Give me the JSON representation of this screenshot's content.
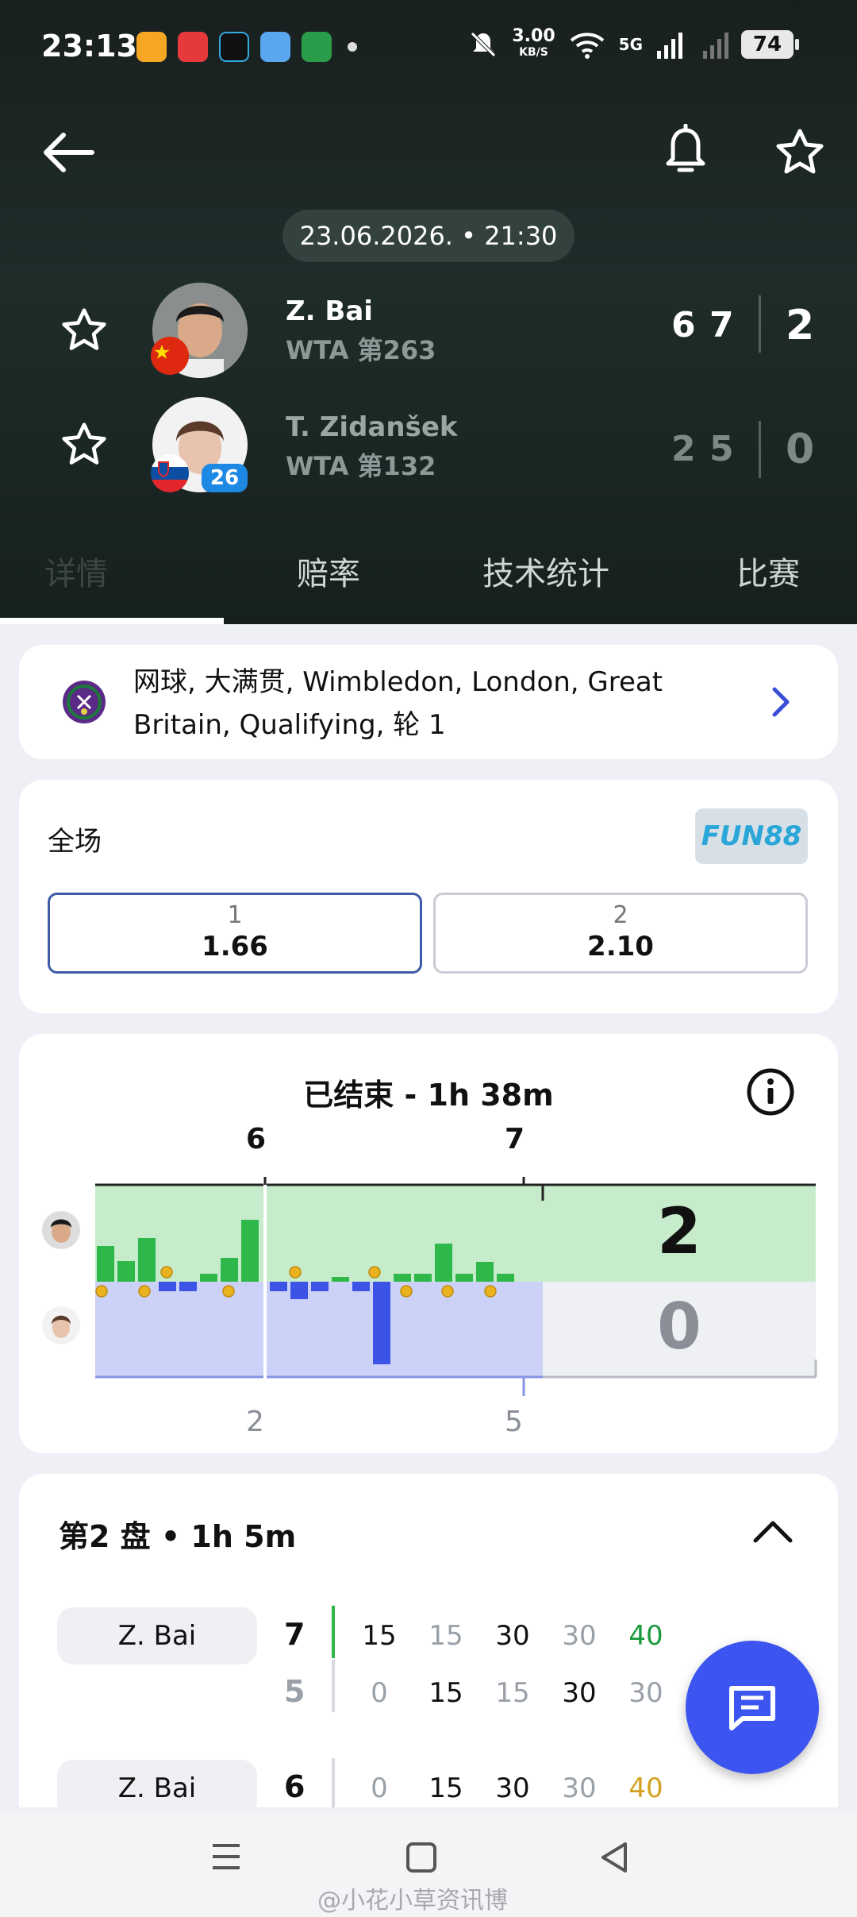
{
  "status_bar": {
    "time": "23:13",
    "speed": "3.00",
    "speed_unit": "KB/S",
    "network": "5G",
    "battery": "74",
    "icons": [
      "weibo-icon",
      "video-icon",
      "tiktok-icon",
      "weather-icon",
      "oppo-icon",
      "mute-icon",
      "wifi-icon",
      "signal-icon"
    ]
  },
  "header": {
    "date_time": "23.06.2026. • 21:30",
    "icons": [
      "back-arrow-icon",
      "bell-icon",
      "star-icon"
    ],
    "players": [
      {
        "name": "Z. Bai",
        "rank": "WTA 第263",
        "flag": "china",
        "sets": [
          "6",
          "7"
        ],
        "total": "2"
      },
      {
        "name": "T. Zidanšek",
        "rank": "WTA 第132",
        "flag": "slovenia",
        "seed": "26",
        "sets": [
          "2",
          "5"
        ],
        "total": "0"
      }
    ]
  },
  "tabs": [
    {
      "label": "详情"
    },
    {
      "label": "赔率"
    },
    {
      "label": "技术统计"
    },
    {
      "label": "比赛"
    }
  ],
  "competition": {
    "line1": "网球, 大满贯, Wimbledon, London, Great",
    "line2": "Britain, Qualifying, 轮 1"
  },
  "odds": {
    "title": "全场",
    "bookmaker": "FUN88",
    "options": [
      {
        "label": "1",
        "value": "1.66"
      },
      {
        "label": "2",
        "value": "2.10"
      }
    ]
  },
  "momentum": {
    "title": "已结束 - 1h 38m",
    "set1_top": "6",
    "set2_top": "7",
    "set1_bottom": "2",
    "set2_bottom": "5",
    "total_home": "2",
    "total_away": "0",
    "colors": {
      "home": "#2fb84a",
      "home_bg": "#c6eccb",
      "away": "#3b54e6",
      "away_bg": "#ccd2f7"
    }
  },
  "set_detail": {
    "title": "第2 盘 • 1h 5m",
    "games": [
      {
        "player": "Z. Bai",
        "home": "7",
        "away": "5",
        "home_points": [
          "15",
          "15",
          "30",
          "30",
          "40"
        ],
        "away_points": [
          "0",
          "15",
          "15",
          "30",
          "30"
        ]
      },
      {
        "player": "Z. Bai",
        "home": "6",
        "away": "",
        "home_points": [
          "0",
          "15",
          "30",
          "30",
          "40"
        ]
      }
    ]
  },
  "watermark": "@小花小草资讯博"
}
